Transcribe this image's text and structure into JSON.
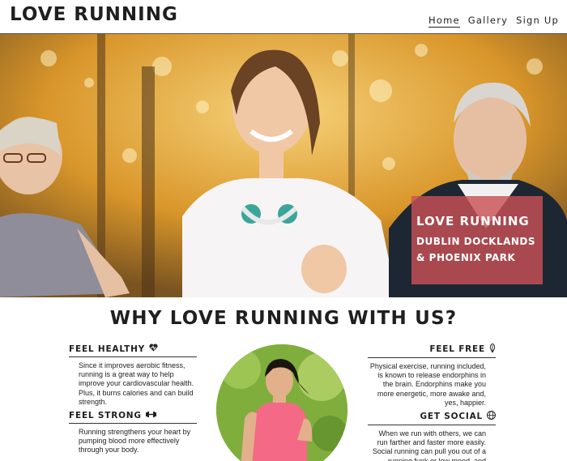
{
  "header": {
    "logo": "LOVE RUNNING",
    "nav": [
      {
        "label": "Home",
        "active": true
      },
      {
        "label": "Gallery",
        "active": false
      },
      {
        "label": "Sign Up",
        "active": false
      }
    ]
  },
  "hero": {
    "title": "LOVE RUNNING",
    "subtitle": "DUBLIN DOCKLANDS & PHOENIX PARK",
    "box_color": "#c85055"
  },
  "section": {
    "title": "WHY LOVE RUNNING WITH US?"
  },
  "features": {
    "healthy": {
      "title": "FEEL HEALTHY",
      "icon": "heartbeat-icon",
      "text": "Since it improves aerobic fitness, running is a great way to help improve your cardiovascular health. Plus, it burns calories and can build strength."
    },
    "strong": {
      "title": "FEEL STRONG",
      "icon": "dumbbell-icon",
      "text": "Running strengthens your heart by pumping blood more effectively through your body."
    },
    "free": {
      "title": "FEEL FREE",
      "icon": "feather-icon",
      "text": "Physical exercise, running included, is known to release endorphins in the brain. Endorphins make you more energetic, more awake and, yes, happier."
    },
    "social": {
      "title": "GET SOCIAL",
      "icon": "globe-icon",
      "text": "When we run with others, we can run farther and faster more easily. Social running can pull you out of a running funk or low mood, and"
    }
  }
}
